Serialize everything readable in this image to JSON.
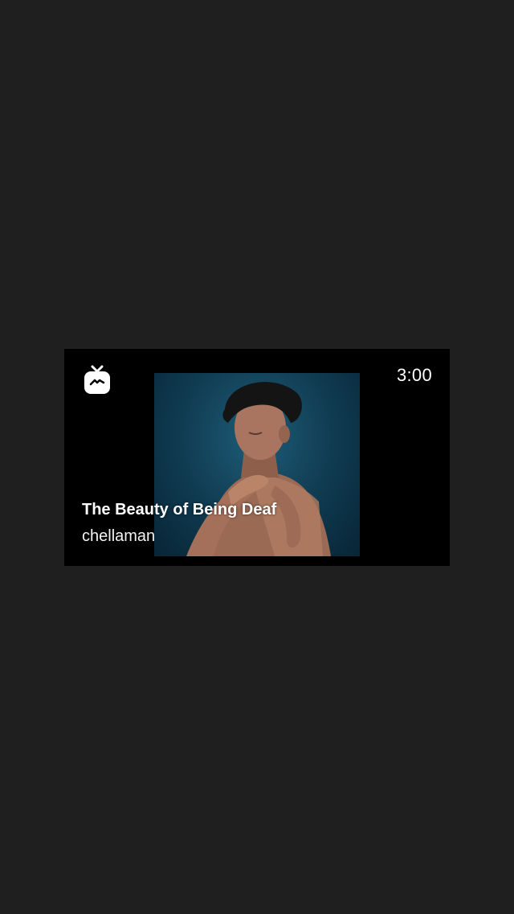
{
  "video": {
    "duration": "3:00",
    "title": "The Beauty of Being Deaf",
    "author": "chellaman"
  },
  "icons": {
    "brand": "igtv-icon"
  },
  "colors": {
    "background": "#1f1f1f",
    "card": "#000000",
    "text": "#ffffff"
  }
}
